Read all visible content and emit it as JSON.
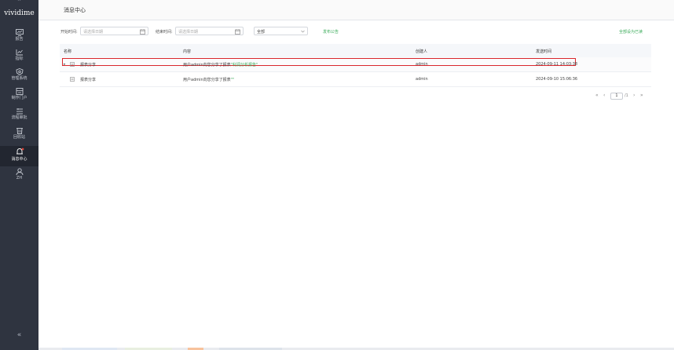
{
  "sidebar": {
    "brand": "vividime",
    "top_caret": "^",
    "collapse_icon": "«",
    "items": [
      {
        "label": "报告",
        "icon": "report-icon"
      },
      {
        "label": "指标",
        "icon": "metrics-icon"
      },
      {
        "label": "管理系统",
        "icon": "admin-system-icon"
      },
      {
        "label": "制作门户",
        "icon": "portal-icon"
      },
      {
        "label": "流程审批",
        "icon": "approval-icon"
      },
      {
        "label": "回收站",
        "icon": "trash-icon"
      },
      {
        "label": "消息中心",
        "icon": "bell-icon",
        "active": true
      },
      {
        "label": "ZH",
        "icon": "user-icon"
      }
    ]
  },
  "header": {
    "title": "消息中心"
  },
  "filters": {
    "start_label": "开始时间:",
    "start_placeholder": "请选择日期",
    "end_label": "结束时间:",
    "end_placeholder": "请选择日期",
    "type_value": "全部",
    "publish_link": "发布公告",
    "mark_all_read": "全部设为已读"
  },
  "table": {
    "columns": [
      "名称",
      "内容",
      "创建人",
      "发送时间"
    ],
    "rows": [
      {
        "name": "报表分享",
        "content_prefix": "用户admin向您分享了报表",
        "content_highlight": "\"利润分析报告\"",
        "creator": "admin",
        "time": "2024-09-11 14:03:38",
        "selected": true
      },
      {
        "name": "报表分享",
        "content_prefix": "用户admin向您分享了报表",
        "content_highlight": "\"\"",
        "creator": "admin",
        "time": "2024-09-10 15:06:36",
        "selected": false
      }
    ]
  },
  "pagination": {
    "first": "«",
    "prev": "‹",
    "current": "1",
    "total": "/1",
    "next": "›",
    "last": "»"
  },
  "colors": {
    "sidebar_bg": "#2f3440",
    "accent": "#3bab5a",
    "highlight_border": "#d9262c"
  }
}
